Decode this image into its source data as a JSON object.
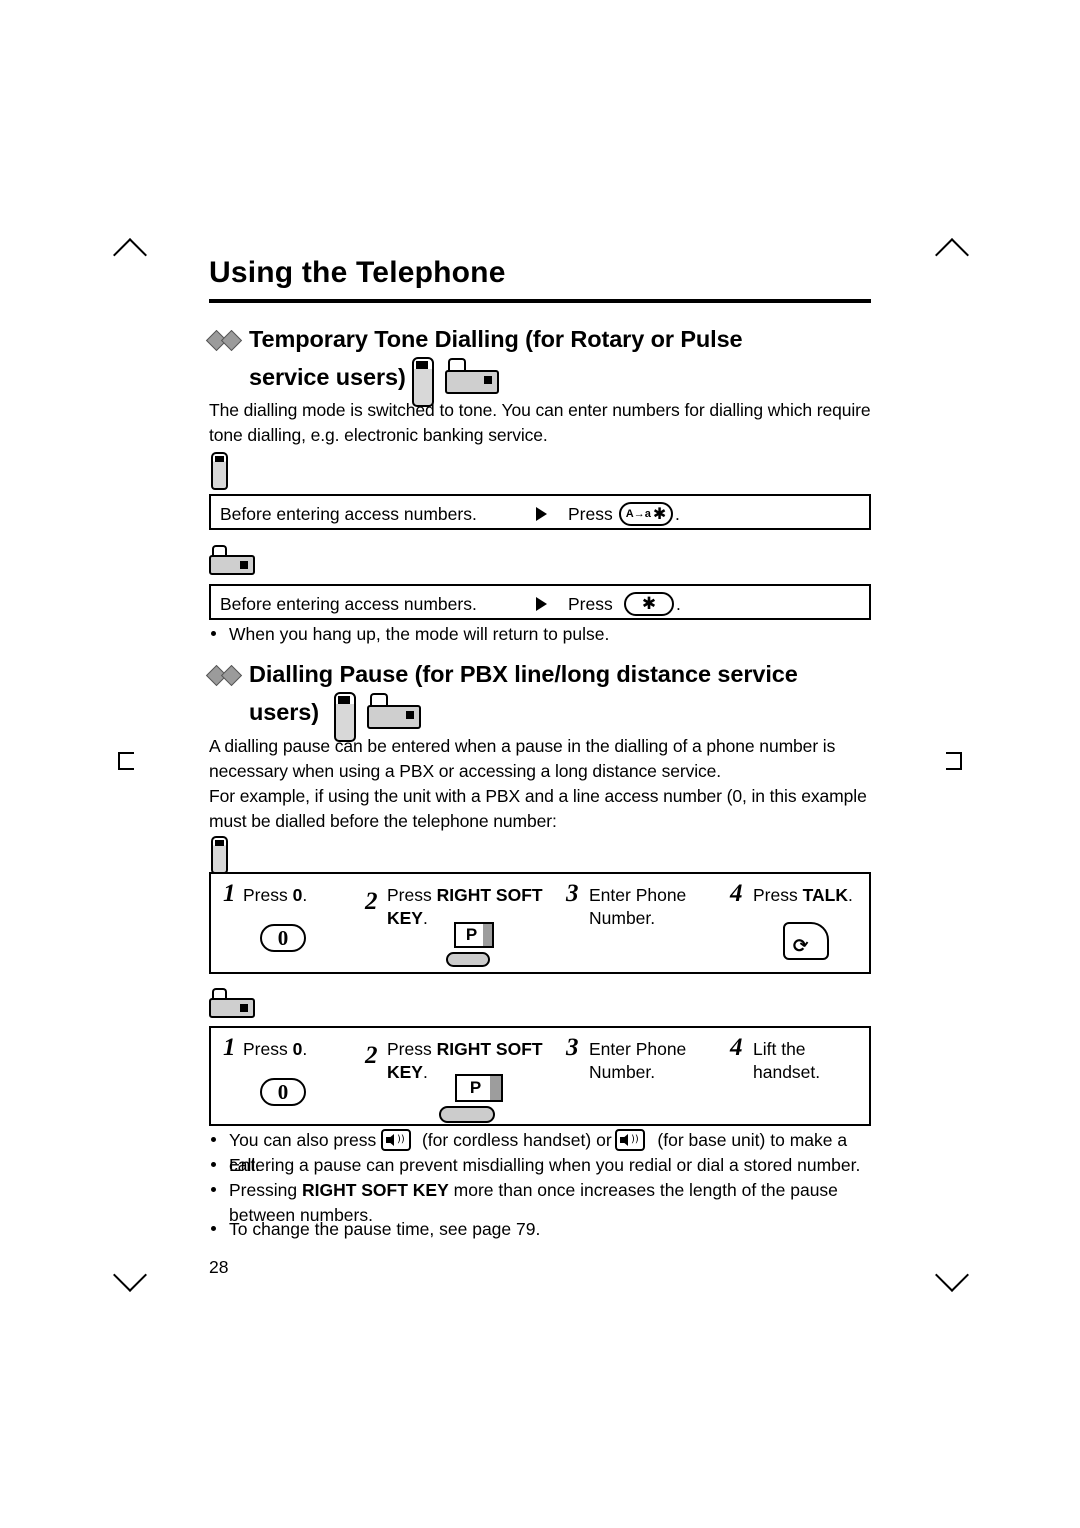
{
  "page": {
    "chapter_title": "Using the Telephone",
    "page_number": "28"
  },
  "section1": {
    "heading_line1": "Temporary Tone Dialling (for Rotary or Pulse",
    "heading_line2": "service users)",
    "paragraph": "The dialling mode is switched to tone. You can enter numbers for dialling which require tone dialling, e.g. electronic banking service.",
    "handset_box": {
      "condition": "Before entering access numbers.",
      "press_label": "Press",
      "key_label": "A→a",
      "key_symbol": "✱",
      "period": "."
    },
    "base_box": {
      "condition": "Before entering access numbers.",
      "press_label": "Press",
      "key_symbol": "✱",
      "period": "."
    },
    "note": "When you hang up, the mode will return to pulse."
  },
  "section2": {
    "heading_line1": "Dialling Pause (for PBX line/long distance service",
    "heading_line2": "users)",
    "paragraph1": "A dialling pause can be entered when a pause in the dialling of a phone number is necessary when using a PBX or accessing a long distance service.",
    "paragraph2": "For example, if using the unit with a PBX and a line access number (0, in this example must be dialled before the telephone number:",
    "handset_steps": [
      {
        "num": "1",
        "text_plain": "Press ",
        "text_bold": "0",
        "text_tail": ".",
        "glyph": "0"
      },
      {
        "num": "2",
        "text_plain": "Press ",
        "text_bold": "RIGHT SOFT KEY",
        "text_tail": ".",
        "glyph": "P"
      },
      {
        "num": "3",
        "text_plain": "Enter Phone Number.",
        "text_bold": "",
        "text_tail": "",
        "glyph": ""
      },
      {
        "num": "4",
        "text_plain": "Press ",
        "text_bold": "TALK",
        "text_tail": ".",
        "glyph": "talk"
      }
    ],
    "base_steps": [
      {
        "num": "1",
        "text_plain": "Press ",
        "text_bold": "0",
        "text_tail": ".",
        "glyph": "0"
      },
      {
        "num": "2",
        "text_plain": "Press ",
        "text_bold": "RIGHT SOFT KEY",
        "text_tail": ".",
        "glyph": "P"
      },
      {
        "num": "3",
        "text_plain": "Enter Phone Number.",
        "text_bold": "",
        "text_tail": "",
        "glyph": ""
      },
      {
        "num": "4",
        "text_plain": "Lift the handset.",
        "text_bold": "",
        "text_tail": "",
        "glyph": ""
      }
    ],
    "notes": {
      "note1_a": "You can also press",
      "note1_b": "(for cordless handset) or",
      "note1_c": "(for base unit) to make a call.",
      "note2": "Entering a pause can prevent misdialling when you redial or dial a stored number.",
      "note3_a": "Pressing ",
      "note3_bold": "RIGHT SOFT KEY",
      "note3_b": " more than once increases the length of the pause between numbers.",
      "note4": "To change the pause time, see page 79."
    }
  },
  "icons": {
    "handset": "cordless-handset-icon",
    "base": "base-unit-icon",
    "star_key": "star-key-icon",
    "soft_key": "right-soft-key-icon",
    "talk_key": "talk-key-icon",
    "speakerphone": "speakerphone-icon",
    "zero_key": "zero-key-icon"
  }
}
